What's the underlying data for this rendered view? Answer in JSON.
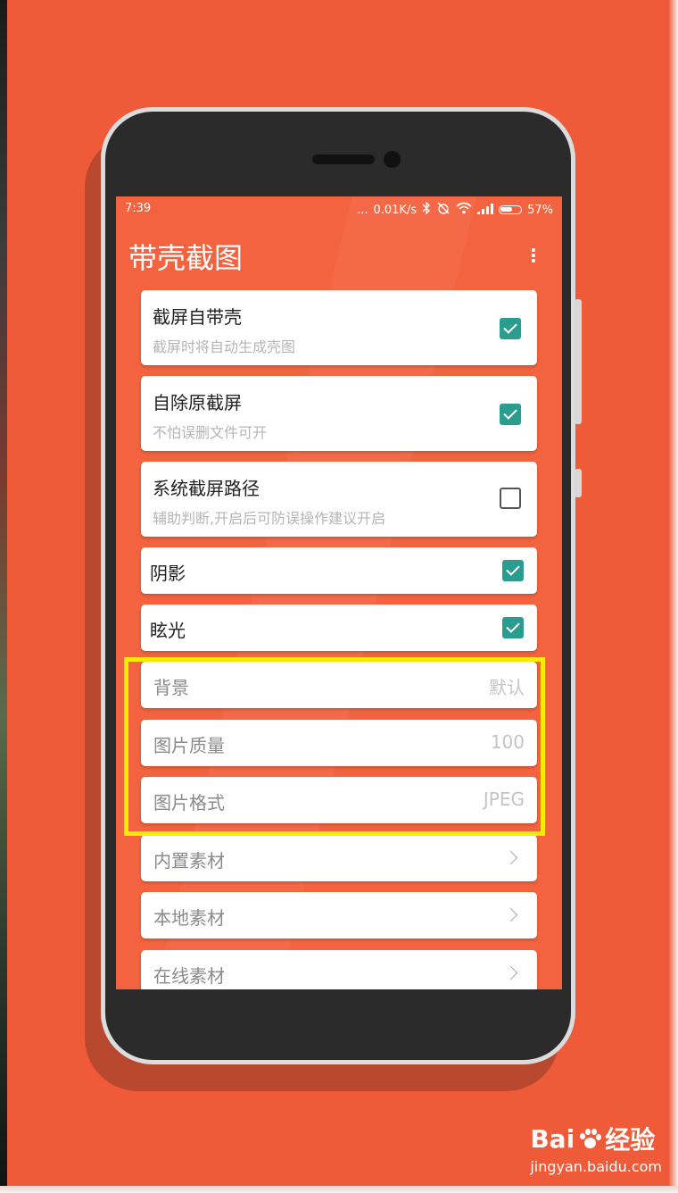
{
  "status_bar": {
    "time": "7:39",
    "dots": "...",
    "speed": "0.01K/s",
    "battery": "57%",
    "icons": [
      "bluetooth-icon",
      "alarm-off-icon",
      "wifi-icon",
      "signal-icon",
      "battery-icon"
    ]
  },
  "app": {
    "title": "带壳截图"
  },
  "settings": [
    {
      "title": "截屏自带壳",
      "subtitle": "截屏时将自动生成壳图",
      "checked": true
    },
    {
      "title": "自除原截屏",
      "subtitle": "不怕误删文件可开",
      "checked": true
    },
    {
      "title": "系统截屏路径",
      "subtitle": "辅助判断,开启后可防误操作建议开启",
      "checked": false
    },
    {
      "title": "阴影",
      "checked": true
    },
    {
      "title": "眩光",
      "checked": true
    }
  ],
  "value_items": [
    {
      "label": "背景",
      "value": "默认"
    },
    {
      "label": "图片质量",
      "value": "100"
    },
    {
      "label": "图片格式",
      "value": "JPEG"
    }
  ],
  "nav_items": [
    {
      "label": "内置素材"
    },
    {
      "label": "本地素材"
    },
    {
      "label": "在线素材"
    }
  ],
  "watermark": {
    "brand": "Bai",
    "brand_suffix": "经验",
    "url": "jingyan.baidu.com"
  },
  "colors": {
    "background": "#ef5a38",
    "screen": "#f4633f",
    "checkbox_accent": "#2a9d8f",
    "highlight_box": "#f7ec00"
  }
}
